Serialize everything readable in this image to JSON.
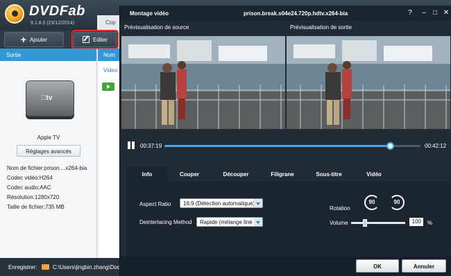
{
  "app": {
    "logo_text": "DVDFab",
    "version": "9.1.8.0 (23/12/2014)",
    "tab_partial": "Cop",
    "toolbar": {
      "add_label": "Ajouter",
      "edit_label": "Editer"
    },
    "left_panel": {
      "header": "Sortie",
      "device_logo": "tv",
      "device_name": "Apple TV",
      "advanced_button": "Réglages avancés",
      "specs": [
        "Nom de fichier:prison....x264-bia",
        "Codec vidéo:H264",
        "Codec audio:AAC",
        "Résolution:1280x720",
        "Taille de fichier:735 MB"
      ]
    },
    "list": {
      "header": "Nom",
      "row_label": "Video"
    },
    "bottom": {
      "save_label": "Enregistrer:",
      "save_path": "C:\\Users\\jingbin.zhang\\Doc"
    }
  },
  "dialog": {
    "title": "Montage vidéo",
    "file_name": "prison.break.s04e24.720p.hdtv.x264-bia",
    "window_buttons": {
      "help": "?",
      "minimize": "–",
      "maximize": "□",
      "close": "✕"
    },
    "source_label": "Prévisualisation de source",
    "output_label": "Prévisualisation de sortie",
    "timeline": {
      "current": "00:37:19",
      "total": "00:42:12",
      "progress": 0.884
    },
    "tabs": [
      "Info",
      "Couper",
      "Découper",
      "Filigrane",
      "Sous-titre",
      "Vidéo"
    ],
    "active_tab": 0,
    "settings": {
      "aspect_label": "Aspect Ratio",
      "aspect_value": "16:9 (Détection automatique)",
      "deint_label": "Deinterlacing Method",
      "deint_value": "Rapide (mélange liné",
      "rotation_label": "Rotation",
      "rotate_left": "90",
      "rotate_right": "90",
      "volume_label": "Volume",
      "volume_value": "100",
      "volume_unit": "%",
      "volume_level": 0.25
    },
    "buttons": {
      "ok": "OK",
      "cancel": "Annuler"
    }
  },
  "colors": {
    "accent": "#3398d6",
    "highlight_border": "#d8312e",
    "dialog_bg": "#202b36"
  },
  "icons": [
    "plus-icon",
    "edit-icon",
    "folder-icon",
    "pause-icon",
    "rotate-left-icon",
    "rotate-right-icon",
    "dropdown-arrow-icon"
  ]
}
